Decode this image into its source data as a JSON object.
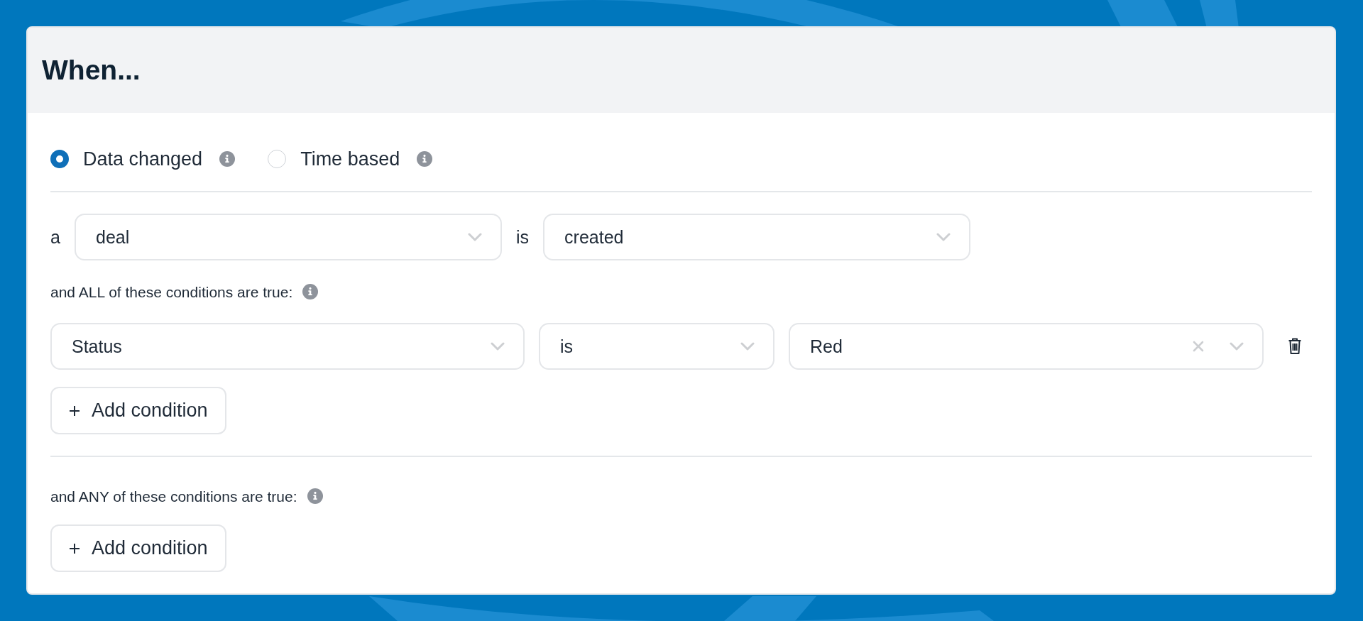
{
  "title": "When...",
  "trigger_options": [
    {
      "label": "Data changed",
      "selected": true
    },
    {
      "label": "Time based",
      "selected": false
    }
  ],
  "subject": {
    "prefix": "a",
    "value": "deal",
    "verb": "is",
    "event": "created"
  },
  "all_section": {
    "label": "and ALL of these conditions are true:",
    "conditions": [
      {
        "field": "Status",
        "operator": "is",
        "value": "Red",
        "clearable": true
      }
    ],
    "add_button": "Add condition"
  },
  "any_section": {
    "label": "and ANY of these conditions are true:",
    "add_button": "Add condition"
  }
}
